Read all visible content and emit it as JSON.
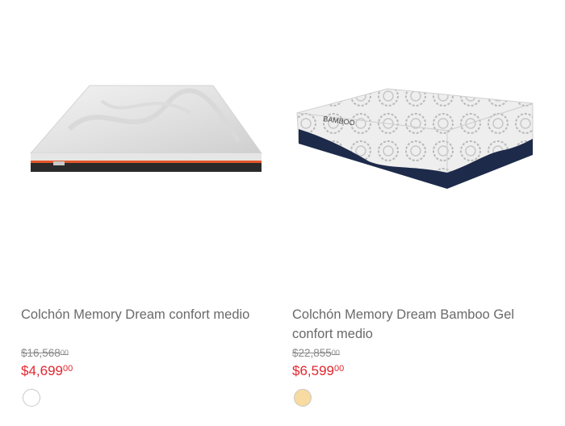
{
  "products": [
    {
      "name": "Colchón Memory Dream confort medio",
      "old_price_main": "$16,568",
      "old_price_cents": "00",
      "price_main": "$4,699",
      "price_cents": "00",
      "swatch_color": "#ffffff"
    },
    {
      "name": "Colchón Memory Dream Bamboo Gel confort medio",
      "old_price_main": "$22,855",
      "old_price_cents": "00",
      "price_main": "$6,599",
      "price_cents": "00",
      "swatch_color": "#f7dba0"
    }
  ]
}
